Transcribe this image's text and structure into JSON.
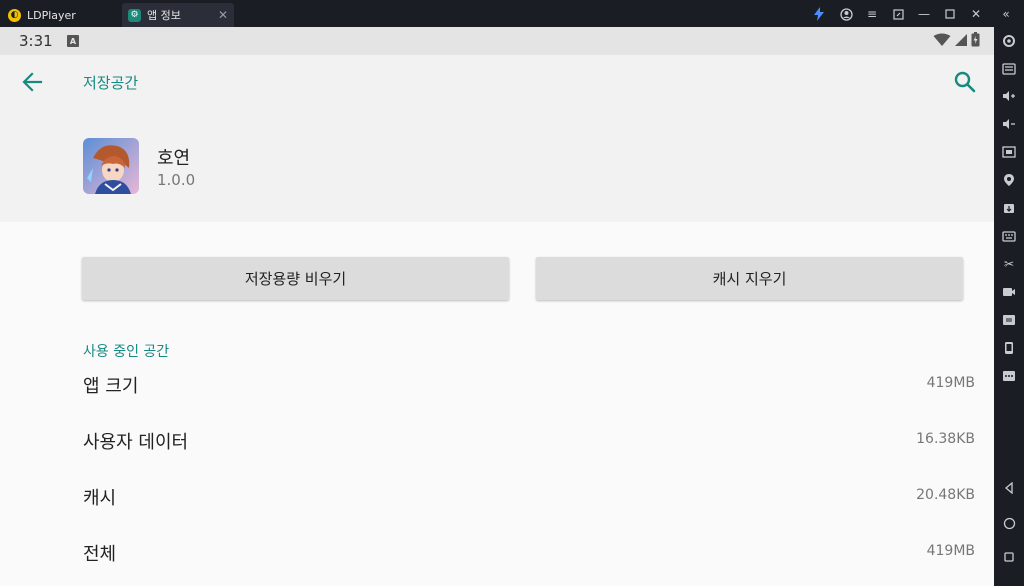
{
  "window": {
    "tabs": [
      {
        "label": "LDPlayer"
      },
      {
        "label": "앱 정보"
      }
    ]
  },
  "status_bar": {
    "time": "3:31",
    "notification_badge": "A"
  },
  "app_bar": {
    "title": "저장공간"
  },
  "app": {
    "name": "호연",
    "version": "1.0.0"
  },
  "actions": {
    "clear_storage_label": "저장용량 비우기",
    "clear_cache_label": "캐시 지우기"
  },
  "storage": {
    "section_title": "사용 중인 공간",
    "rows": [
      {
        "label": "앱 크기",
        "value": "419MB"
      },
      {
        "label": "사용자 데이터",
        "value": "16.38KB"
      },
      {
        "label": "캐시",
        "value": "20.48KB"
      },
      {
        "label": "전체",
        "value": "419MB"
      }
    ]
  },
  "colors": {
    "accent": "#178a80",
    "emulator_chrome": "#1b1d24",
    "button_bg": "#dcdcdc"
  },
  "icons": {
    "window_controls": [
      "lightning-icon",
      "account-icon",
      "menu-icon",
      "restore-icon",
      "minimize-icon",
      "maximize-icon",
      "close-icon",
      "collapse-icon"
    ],
    "sidebar": [
      "settings-icon",
      "keyboard-mapping-icon",
      "volume-up-icon",
      "volume-down-icon",
      "screenshot-icon",
      "location-icon",
      "install-apk-icon",
      "keyboard-icon",
      "scissors-icon",
      "record-icon",
      "folder-icon",
      "phone-icon",
      "more-icon",
      "android-back-icon",
      "android-home-icon",
      "android-recents-icon"
    ]
  }
}
